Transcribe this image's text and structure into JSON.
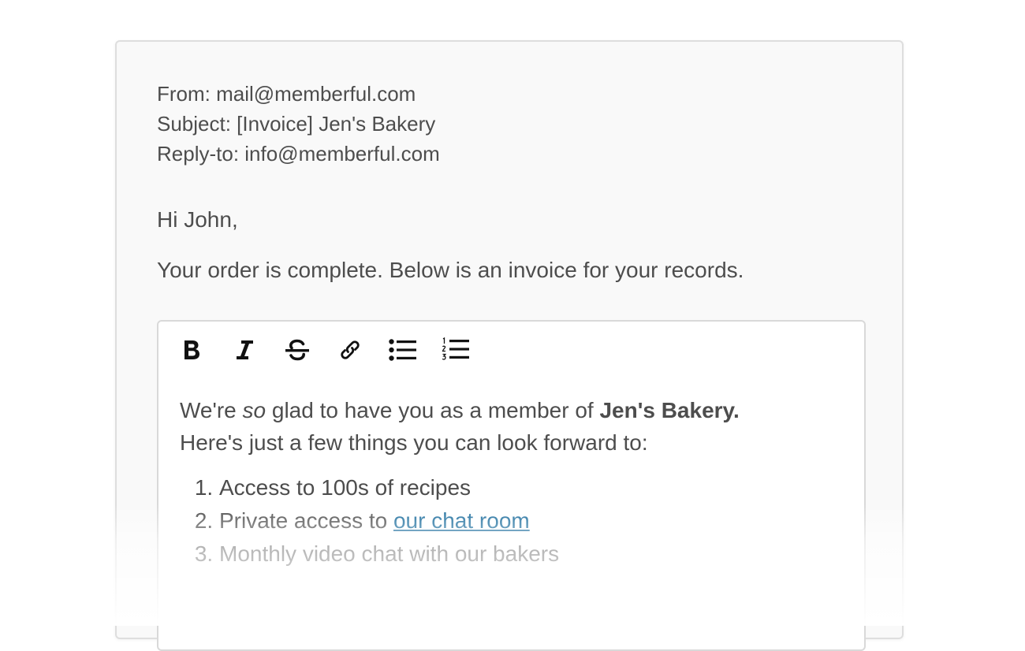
{
  "email": {
    "from": "From: mail@memberful.com",
    "subject": "Subject: [Invoice] Jen's Bakery",
    "reply_to": "Reply-to: info@memberful.com",
    "greeting": "Hi John,",
    "intro": "Your order is complete. Below is an invoice for your records."
  },
  "toolbar": {
    "buttons": [
      {
        "name": "bold",
        "icon": "bold-icon"
      },
      {
        "name": "italic",
        "icon": "italic-icon"
      },
      {
        "name": "strikethrough",
        "icon": "strikethrough-icon"
      },
      {
        "name": "link",
        "icon": "link-icon"
      },
      {
        "name": "bullet-list",
        "icon": "bullet-list-icon"
      },
      {
        "name": "numbered-list",
        "icon": "numbered-list-icon"
      }
    ]
  },
  "editor": {
    "line1_prefix": "We're ",
    "line1_emphasis": "so",
    "line1_middle": " glad to have you as a member of ",
    "line1_bold": "Jen's Bakery.",
    "line2": "Here's just a few things you can look forward to:",
    "list": [
      "Access to 100s of recipes",
      "Private access to ",
      "Monthly video chat with our bakers"
    ],
    "link_text": "our chat room"
  },
  "colors": {
    "text": "#4d4d4d",
    "link": "#1a6c9c",
    "card_bg": "#f9f9f9",
    "editor_bg": "#ffffff"
  }
}
